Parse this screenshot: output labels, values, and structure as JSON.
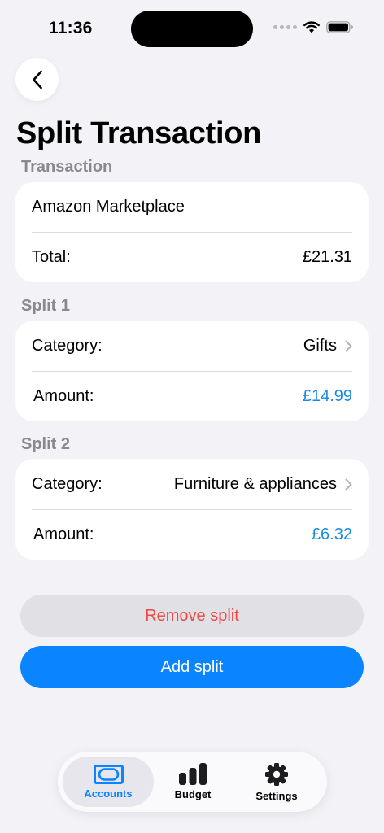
{
  "status_bar": {
    "time": "11:36"
  },
  "page": {
    "title": "Split Transaction"
  },
  "transaction": {
    "header": "Transaction",
    "merchant": "Amazon Marketplace",
    "total_label": "Total:",
    "total_value": "£21.31"
  },
  "splits": [
    {
      "header": "Split 1",
      "category_label": "Category:",
      "category_value": "Gifts",
      "amount_label": "Amount:",
      "amount_value": "£14.99"
    },
    {
      "header": "Split 2",
      "category_label": "Category:",
      "category_value": "Furniture & appliances",
      "amount_label": "Amount:",
      "amount_value": "£6.32"
    }
  ],
  "buttons": {
    "remove_split": "Remove split",
    "add_split": "Add split"
  },
  "tab_bar": {
    "items": [
      {
        "label": "Accounts",
        "icon": "wallet-card-icon",
        "active": true
      },
      {
        "label": "Budget",
        "icon": "bar-chart-icon",
        "active": false
      },
      {
        "label": "Settings",
        "icon": "gear-icon",
        "active": false
      }
    ]
  },
  "colors": {
    "accent": "#0a84ff",
    "amount": "#1a8ae0",
    "destructive": "#ef4746",
    "background": "#f2f2f7"
  }
}
